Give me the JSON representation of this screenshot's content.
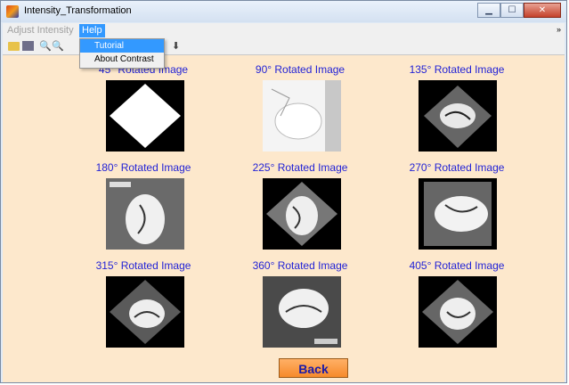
{
  "window": {
    "title": "Intensity_Transformation",
    "controls": [
      "minimize",
      "maximize",
      "close"
    ]
  },
  "menubar": {
    "items": [
      {
        "label": "Adjust Intensity",
        "state": "disabled"
      },
      {
        "label": "Help",
        "state": "open"
      }
    ]
  },
  "help_menu": {
    "items": [
      "Tutorial",
      "About Contrast"
    ],
    "highlighted": "Tutorial"
  },
  "toolbar": {
    "icons": [
      "open-folder-icon",
      "save-icon",
      "zoom-in-icon",
      "zoom-out-icon",
      "data-cursor-icon"
    ]
  },
  "images": [
    {
      "label": "45° Rotated Image"
    },
    {
      "label": "90° Rotated Image"
    },
    {
      "label": "135° Rotated Image"
    },
    {
      "label": "180° Rotated Image"
    },
    {
      "label": "225° Rotated Image"
    },
    {
      "label": "270° Rotated Image"
    },
    {
      "label": "315° Rotated Image"
    },
    {
      "label": "360° Rotated Image"
    },
    {
      "label": "405° Rotated Image"
    }
  ],
  "back_button": {
    "label": "Back"
  },
  "colors": {
    "canvas_bg": "#fde8cc",
    "label_text": "#2323d6",
    "menu_highlight": "#3399ff",
    "back_button": "#f68a2a"
  }
}
